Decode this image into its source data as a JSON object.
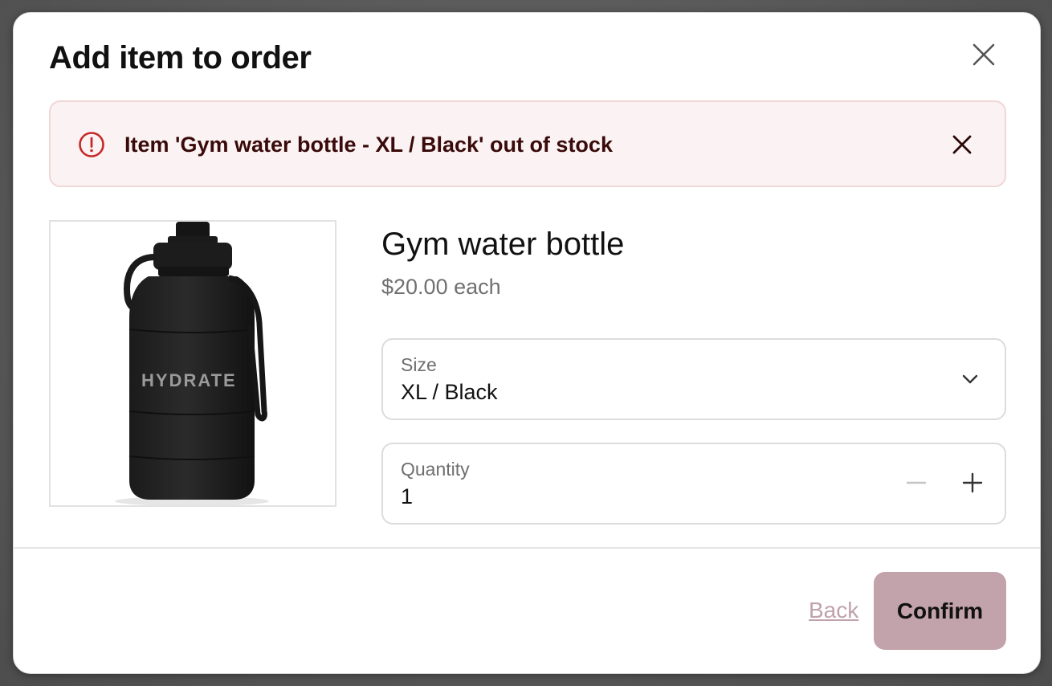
{
  "dialog": {
    "title": "Add item to order",
    "close_icon": "close-icon"
  },
  "alert": {
    "icon": "error-circle-icon",
    "message": "Item 'Gym water bottle - XL / Black' out of stock",
    "dismiss_icon": "close-icon",
    "accent_color": "#c62828"
  },
  "product": {
    "name": "Gym water bottle",
    "price": "$20.00 each",
    "image": {
      "brand_text": "HYDRATE"
    }
  },
  "size_field": {
    "label": "Size",
    "value": "XL / Black",
    "icon": "chevron-down-icon"
  },
  "quantity_field": {
    "label": "Quantity",
    "value": "1",
    "decrement_icon": "minus-icon",
    "increment_icon": "plus-icon"
  },
  "footer": {
    "back_label": "Back",
    "confirm_label": "Confirm",
    "confirm_color": "#c3a3ab"
  }
}
